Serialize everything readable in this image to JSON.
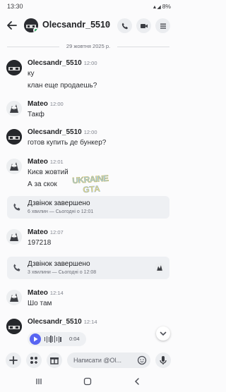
{
  "status_bar": {
    "time": "13:30",
    "battery": "8%"
  },
  "header": {
    "title": "Olecsandr_5510"
  },
  "date_divider": "29 жовтня 2025 р.",
  "messages": [
    {
      "author": "Olecsandr_5510",
      "time": "12:00",
      "lines": [
        "ку",
        "клан еще продаешь?"
      ]
    },
    {
      "author": "Mateo",
      "time": "12:00",
      "lines": [
        "Такф"
      ]
    },
    {
      "author": "Olecsandr_5510",
      "time": "12:00",
      "lines": [
        "готов купить де бункер?"
      ]
    },
    {
      "author": "Mateo",
      "time": "12:01",
      "lines": [
        "Києв жовтий",
        "А за скок"
      ]
    },
    {
      "author": "Mateo",
      "time": "12:07",
      "lines": [
        "197218"
      ]
    },
    {
      "author": "Mateo",
      "time": "12:14",
      "lines": [
        "Шо там"
      ]
    },
    {
      "author": "Olecsandr_5510",
      "time": "12:14",
      "voice_duration": "0:04"
    }
  ],
  "calls": [
    {
      "title": "Дзвінок завершено",
      "subtitle": "6 хвилин — Сьогодні о 12:01"
    },
    {
      "title": "Дзвінок завершено",
      "subtitle": "3 хвилини — Сьогодні о 12:08"
    }
  ],
  "watermark": {
    "line1": "UKRAINE",
    "line2": "GTA"
  },
  "composer": {
    "placeholder": "Написати @Ol..."
  },
  "colors": {
    "accent": "#5865f2",
    "online": "#23a55a",
    "card": "#eef0f3"
  },
  "icons": [
    "back-arrow-icon",
    "phone-icon",
    "video-icon",
    "menu-icon",
    "plus-icon",
    "apps-icon",
    "gift-icon",
    "emoji-icon",
    "mic-icon",
    "play-icon",
    "chevron-down-icon"
  ]
}
